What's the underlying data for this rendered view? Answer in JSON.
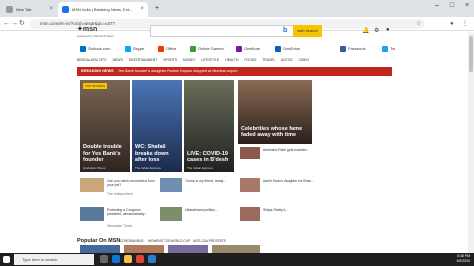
{
  "tabs": [
    {
      "label": "New Tab",
      "active": false
    },
    {
      "label": "MSN India | Breaking News, Ent...",
      "active": true
    }
  ],
  "address": {
    "url": "msn.com/en-in/?ocid=wispr&pc=u477"
  },
  "header": {
    "logo": "msn",
    "logo_sub": "powered by Microsoft News",
    "search_button": "web search"
  },
  "quick_links": [
    {
      "label": "Outlook.com",
      "color": "#0072c6"
    },
    {
      "label": "Skype",
      "color": "#00aff0"
    },
    {
      "label": "Office",
      "color": "#eb3c00"
    },
    {
      "label": "Online Games",
      "color": "#3c9a3c"
    },
    {
      "label": "OneNote",
      "color": "#7719aa"
    },
    {
      "label": "OneDrive",
      "color": "#0364b8"
    },
    {
      "label": "Facebook",
      "color": "#3b5998"
    },
    {
      "label": "Tw",
      "color": "#1da1f2"
    }
  ],
  "nav": [
    "BENGALURU 19°C",
    "NEWS",
    "ENTERTAINMENT",
    "SPORTS",
    "MONEY",
    "LIFESTYLE",
    "HEALTH",
    "FOODS",
    "TRAVEL",
    "AUTOS",
    "VIDEO"
  ],
  "breaking": {
    "tag": "BREAKING NEWS",
    "text": "Yes Bank founder's daughter Roshni Kapoor stopped at Mumbai airport"
  },
  "cards": [
    {
      "badge": "TOP STORIES",
      "caption": "Double trouble for Yes Bank's founder",
      "source": "Hindustan Times"
    },
    {
      "caption": "WC: Shafali breaks down after loss",
      "source": "The Indian Express"
    },
    {
      "caption": "LIVE: COVID-19 cases in B'desh",
      "source": "The Indian Express"
    },
    {
      "caption": "Celebrities whose fame faded away with time",
      "source": ""
    }
  ],
  "small_items": [
    {
      "text": "Can you catch coronavirus from your pet?",
      "source": "The Independent"
    },
    {
      "text": "Trump is my friend, ready...",
      "source": "The Indian Express"
    },
    {
      "text": "Delhi violence: How...",
      "source": "NDTV"
    },
    {
      "text": "Ameesha Patel gets mashed...",
      "source": "Hindustan Times"
    },
    {
      "text": "Aamir Khan's daughter Ira Khan...",
      "source": "Hindustan Times"
    },
    {
      "text": "Priyanka Chopra...",
      "source": "India Today"
    },
    {
      "text": "Protecting a Congress president, democratically...",
      "source": "Hindustan Times"
    },
    {
      "text": "Uttarakhand politics...",
      "source": "The Indian Express"
    },
    {
      "text": "Shilpa Shetty's...",
      "source": "News18"
    },
    {
      "text": "Vicky Kaushal...",
      "source": "Hindustan Times"
    }
  ],
  "popular": {
    "title": "Popular On MSN",
    "tabs": [
      "CORONAVIRUS",
      "WOMEN'S T20 WORLD CUP",
      "ANTI-CAA PROTESTS"
    ]
  },
  "taskbar": {
    "search_placeholder": "Type here to search",
    "time": "5:38 PM",
    "date": "3/9/2020"
  }
}
